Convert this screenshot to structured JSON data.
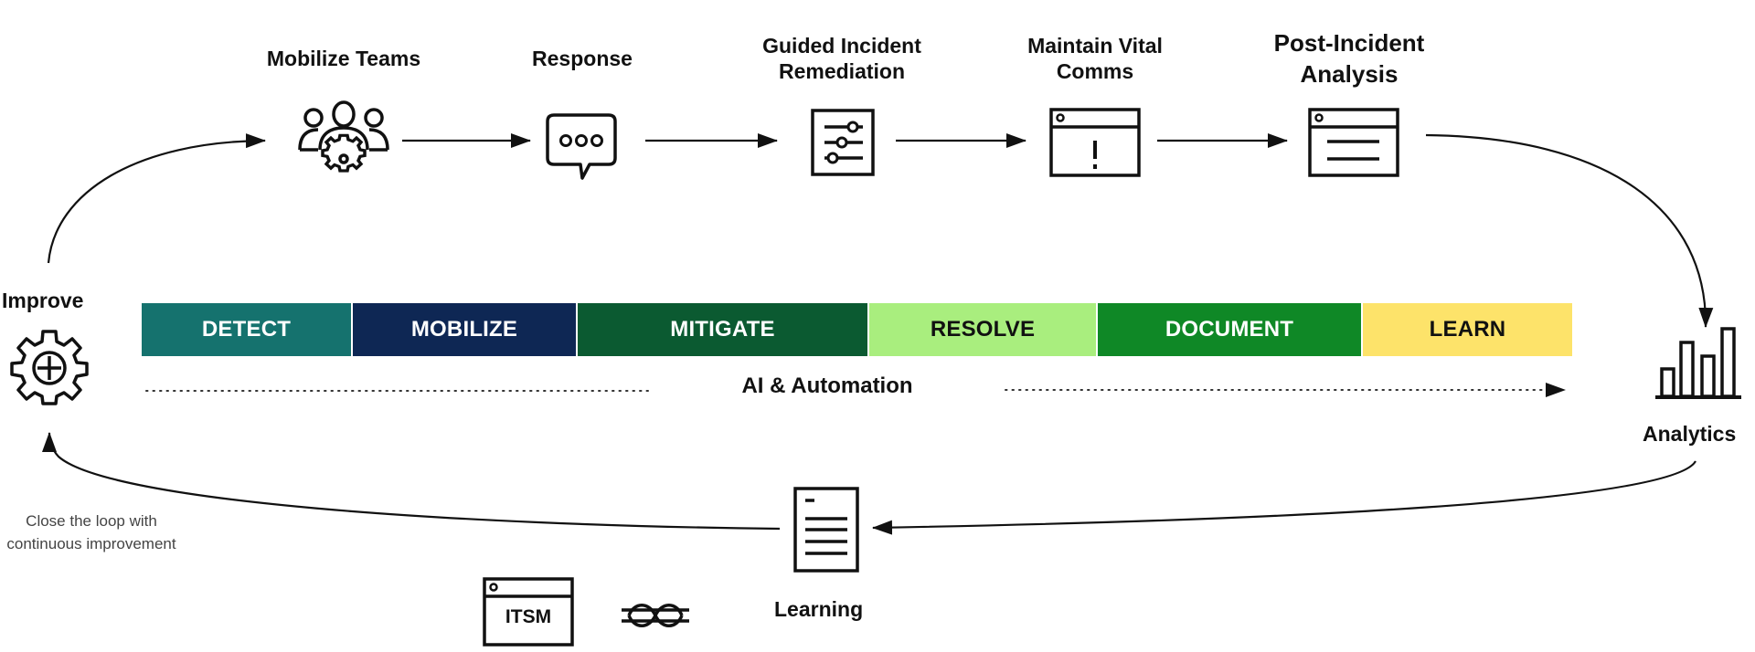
{
  "stages": [
    {
      "id": "mobilize-teams",
      "lines": [
        "Mobilize Teams"
      ],
      "icon": "team-gear-icon"
    },
    {
      "id": "response",
      "lines": [
        "Response"
      ],
      "icon": "chat-bubble-icon"
    },
    {
      "id": "guided-incident-remediation",
      "lines": [
        "Guided Incident",
        "Remediation"
      ],
      "icon": "sliders-document-icon"
    },
    {
      "id": "maintain-vital-comms",
      "lines": [
        "Maintain Vital",
        "Comms"
      ],
      "icon": "alert-window-icon"
    },
    {
      "id": "post-incident-analysis",
      "lines": [
        "Post-Incident",
        "Analysis"
      ],
      "icon": "report-window-icon"
    }
  ],
  "phases": [
    {
      "label": "DETECT",
      "bg": "#15726e",
      "fg": "#ffffff"
    },
    {
      "label": "MOBILIZE",
      "bg": "#0e2754",
      "fg": "#ffffff"
    },
    {
      "label": "MITIGATE",
      "bg": "#0b5a31",
      "fg": "#ffffff"
    },
    {
      "label": "RESOLVE",
      "bg": "#a9ee7e",
      "fg": "#111111"
    },
    {
      "label": "DOCUMENT",
      "bg": "#0f8826",
      "fg": "#ffffff"
    },
    {
      "label": "LEARN",
      "bg": "#fde36a",
      "fg": "#111111"
    }
  ],
  "ai_automation": "AI & Automation",
  "improve": {
    "label": "Improve",
    "icon": "gear-plus-icon"
  },
  "analytics": {
    "label": "Analytics",
    "icon": "bar-chart-icon"
  },
  "learning": {
    "label": "Learning",
    "icon": "document-icon"
  },
  "itsm": {
    "label": "ITSM",
    "icon": "itsm-window-icon"
  },
  "integration_icon": "knot-icon",
  "loop_note": [
    "Close the loop with",
    "continuous improvement"
  ]
}
